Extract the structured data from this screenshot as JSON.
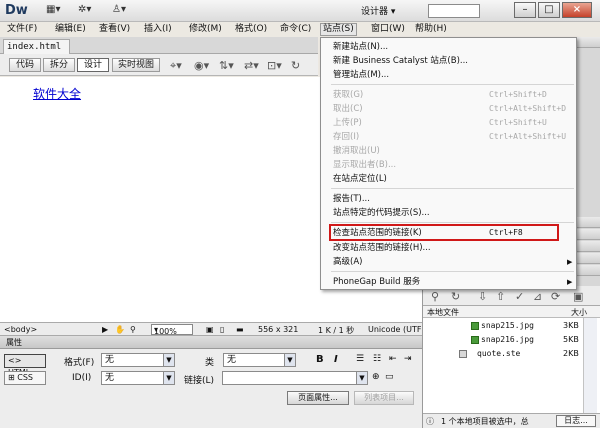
{
  "app": {
    "logo": "Dw",
    "workspace": "设计器",
    "toolbar_icons": [
      "layout-icon",
      "gear-icon",
      "user-icon"
    ]
  },
  "window_buttons": {
    "minimize": "–",
    "maximize": "□",
    "close": "×"
  },
  "menubar": {
    "items": [
      {
        "label": "文件(F)"
      },
      {
        "label": "编辑(E)"
      },
      {
        "label": "查看(V)"
      },
      {
        "label": "插入(I)"
      },
      {
        "label": "修改(M)"
      },
      {
        "label": "格式(O)"
      },
      {
        "label": "命令(C)"
      },
      {
        "label": "站点(S)"
      },
      {
        "label": "窗口(W)"
      },
      {
        "label": "帮助(H)"
      }
    ],
    "active_index": 7
  },
  "document": {
    "tab_name": "index.html",
    "tab_close": "×",
    "view_buttons": [
      "代码",
      "拆分",
      "设计",
      "实时视图"
    ],
    "active_view": "设计",
    "content_link": "软件大全"
  },
  "statusbar": {
    "tag": "<body>",
    "zoom": "100%",
    "dimensions": "556 x 321",
    "size_time": "1 K / 1 秒",
    "encoding": "Unicode (UTF"
  },
  "properties": {
    "title": "属性",
    "html_btn": "<> HTML",
    "css_btn": "CSS",
    "format_label": "格式(F)",
    "format_value": "无",
    "class_label": "类",
    "class_value": "无",
    "id_label": "ID(I)",
    "id_value": "无",
    "link_label": "链接(L)",
    "bold": "B",
    "italic": "I",
    "page_props_btn": "页面属性...",
    "list_item_btn": "列表项目..."
  },
  "files_panel": {
    "col_local": "本地文件",
    "col_size": "大小",
    "files": [
      {
        "name": "snap215.jpg",
        "size": "3KB"
      },
      {
        "name": "snap216.jpg",
        "size": "5KB"
      },
      {
        "name": "quote.ste",
        "size": "2KB"
      }
    ],
    "status": "1 个本地项目被选中，总",
    "log_btn": "日志..."
  },
  "site_menu": {
    "items": [
      {
        "label": "新建站点(N)...",
        "shortcut": "",
        "disabled": false,
        "submenu": false
      },
      {
        "label": "新建 Business Catalyst 站点(B)...",
        "shortcut": "",
        "disabled": false,
        "submenu": false
      },
      {
        "label": "管理站点(M)...",
        "shortcut": "",
        "disabled": false,
        "submenu": false
      },
      {
        "label": "获取(G)",
        "shortcut": "Ctrl+Shift+D",
        "disabled": true,
        "submenu": false
      },
      {
        "label": "取出(C)",
        "shortcut": "Ctrl+Alt+Shift+D",
        "disabled": true,
        "submenu": false
      },
      {
        "label": "上传(P)",
        "shortcut": "Ctrl+Shift+U",
        "disabled": true,
        "submenu": false
      },
      {
        "label": "存回(I)",
        "shortcut": "Ctrl+Alt+Shift+U",
        "disabled": true,
        "submenu": false
      },
      {
        "label": "撤消取出(U)",
        "shortcut": "",
        "disabled": true,
        "submenu": false
      },
      {
        "label": "显示取出者(B)...",
        "shortcut": "",
        "disabled": true,
        "submenu": false
      },
      {
        "label": "在站点定位(L)",
        "shortcut": "",
        "disabled": false,
        "submenu": false
      },
      {
        "label": "报告(T)...",
        "shortcut": "",
        "disabled": false,
        "submenu": false
      },
      {
        "label": "站点特定的代码提示(S)...",
        "shortcut": "",
        "disabled": false,
        "submenu": false
      },
      {
        "label": "检查站点范围的链接(K)",
        "shortcut": "Ctrl+F8",
        "disabled": false,
        "submenu": false,
        "highlighted": true
      },
      {
        "label": "改变站点范围的链接(H)...",
        "shortcut": "",
        "disabled": false,
        "submenu": false
      },
      {
        "label": "高级(A)",
        "shortcut": "",
        "disabled": false,
        "submenu": true
      },
      {
        "label": "PhoneGap Build 服务",
        "shortcut": "",
        "disabled": false,
        "submenu": true
      }
    ],
    "highlight_color": "#d01818"
  }
}
